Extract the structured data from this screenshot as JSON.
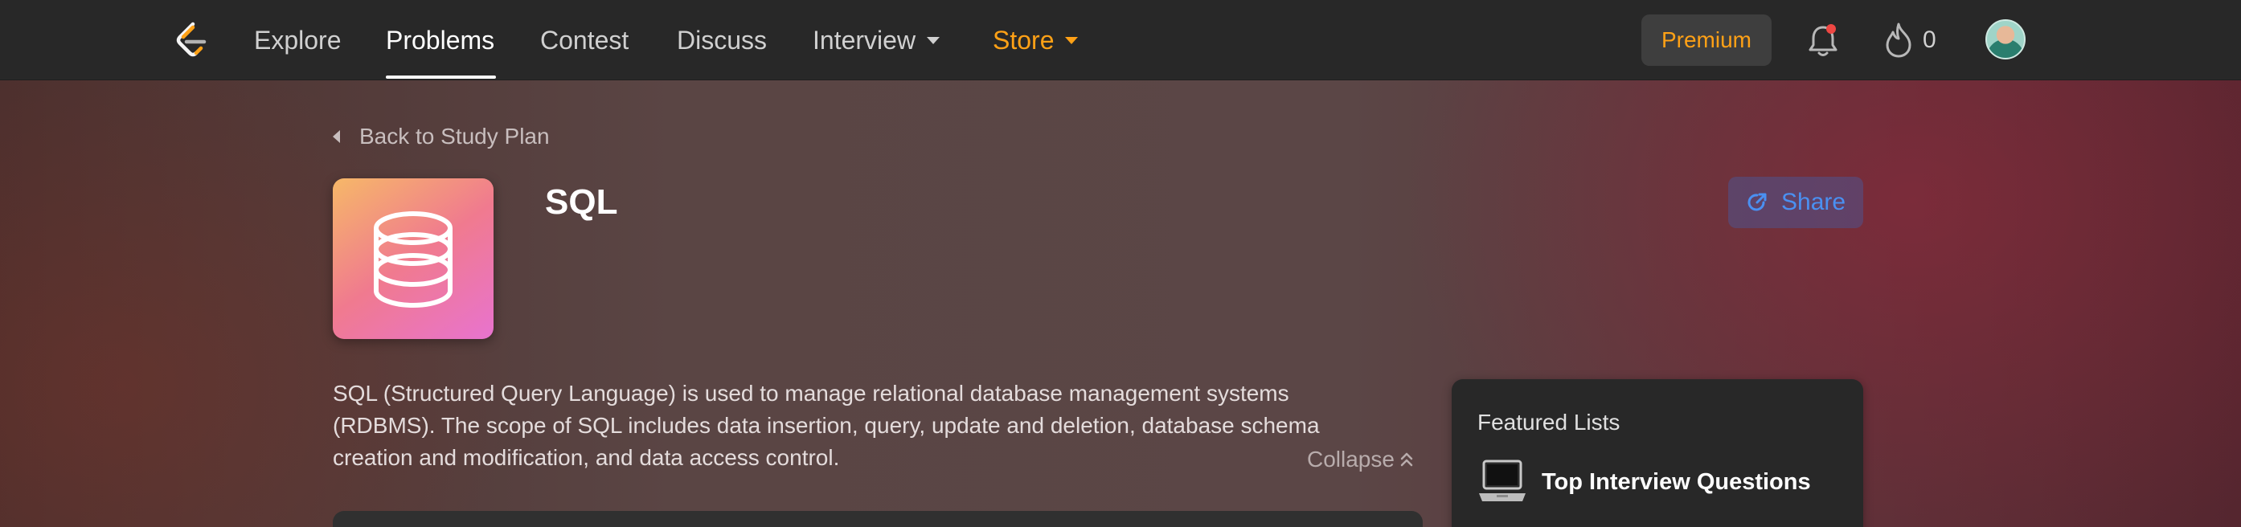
{
  "nav": {
    "items": [
      {
        "label": "Explore"
      },
      {
        "label": "Problems"
      },
      {
        "label": "Contest"
      },
      {
        "label": "Discuss"
      },
      {
        "label": "Interview"
      },
      {
        "label": "Store"
      }
    ],
    "active": "Problems",
    "premium_label": "Premium",
    "streak_count": "0",
    "icons": {
      "logo": "leetcode-logo",
      "notification": "bell-icon",
      "streak": "flame-icon",
      "avatar": "user-avatar"
    }
  },
  "plan": {
    "back_label": "Back to Study Plan",
    "title": "SQL",
    "share_label": "Share",
    "description": "SQL (Structured Query Language) is used to manage relational database management systems (RDBMS). The scope of SQL includes data insertion, query, update and deletion, database schema creation and modification, and data access control.",
    "collapse_label": "Collapse",
    "icon": "database-icon"
  },
  "featured": {
    "title": "Featured Lists",
    "items": [
      {
        "label": "Top Interview Questions",
        "icon": "laptop-icon"
      }
    ]
  },
  "colors": {
    "accent": "#ffa116",
    "share": "#4a90f2",
    "navbar": "#282828"
  }
}
